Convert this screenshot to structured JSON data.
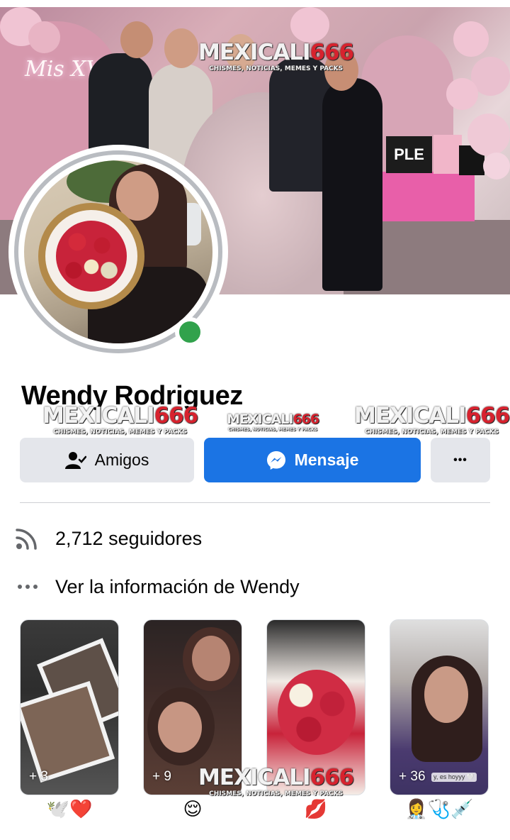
{
  "profile": {
    "name": "Wendy Rodriguez",
    "online": true,
    "cover_neon_text": "Mis XV"
  },
  "watermark": {
    "main": "MEXICALI",
    "number": "666",
    "sub": "CHISMES, NOTICIAS, MEMES Y PACKS"
  },
  "actions": {
    "friends_label": "Amigos",
    "message_label": "Mensaje",
    "more_label": "•••"
  },
  "info": {
    "followers": "2,712 seguidores",
    "about": "Ver la información de Wendy"
  },
  "cover_gift_text": "PLE",
  "featured": [
    {
      "count": "+ 3",
      "caption_emoji": "🕊️❤️"
    },
    {
      "count": "+ 9",
      "caption_emoji": "😌"
    },
    {
      "count": "",
      "caption_emoji": "💋"
    },
    {
      "count": "+ 36",
      "caption_emoji": "👩‍⚕️🩺💉",
      "overlay_text": "y, es hoyyy 🤍"
    }
  ],
  "colors": {
    "primary": "#1b74e4",
    "secondary_button": "#e4e6eb",
    "online": "#31a24c",
    "text": "#050505"
  }
}
